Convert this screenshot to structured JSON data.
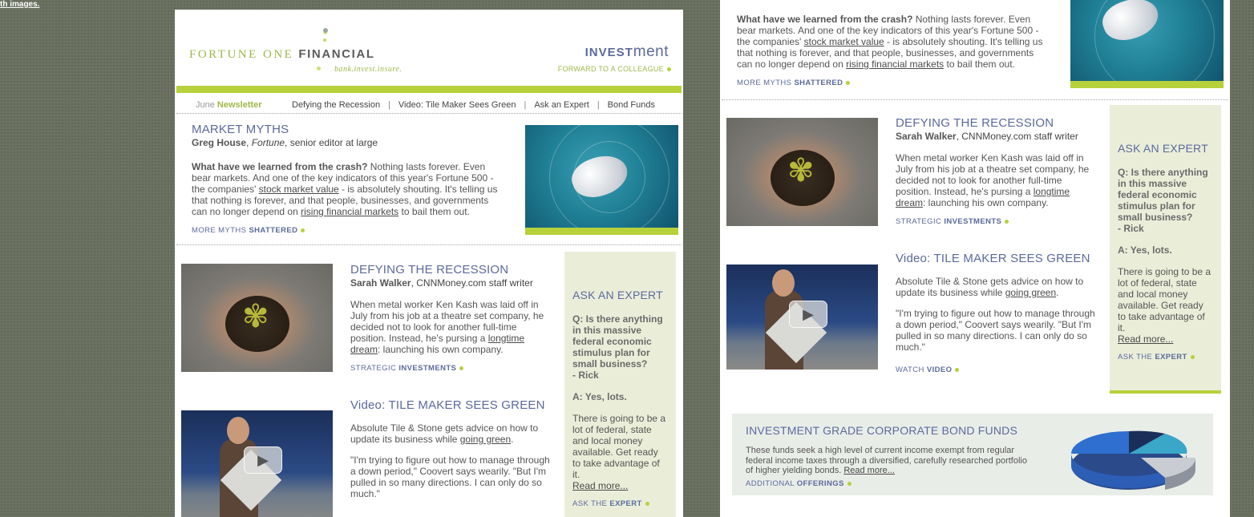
{
  "top_link": "th images.",
  "brand": {
    "name_part1": "FORTUNE ONE",
    "name_part2": "FINANCIAL",
    "tagline": "bank.invest.insure.",
    "section_bold": "INVEST",
    "section_rest": "ment",
    "forward": "FORWARD TO A COLLEAGUE"
  },
  "nav": {
    "issue_month": "June",
    "issue_word": "Newsletter",
    "items": [
      "Defying the Recession",
      "Video: Tile Maker Sees Green",
      "Ask an Expert",
      "Bond Funds"
    ],
    "separator": "|"
  },
  "market_myths": {
    "title": "MARKET MYTHS",
    "author": "Greg House",
    "publication": "Fortune",
    "role": ", senior editor at large",
    "lead": "What have we learned from the crash?",
    "text1": " Nothing lasts forever. Even bear markets. And one of the key indicators of this year's Fortune 500 - the companies' ",
    "link1": "stock market value",
    "text2": " - is absolutely shouting. It's telling us that nothing is forever, and that people, businesses, and governments can no longer depend on ",
    "link2": "rising financial markets",
    "text3": " to bail them out.",
    "more_pre": "MORE MYTHS",
    "more_bold": "SHATTERED"
  },
  "defying": {
    "title": "DEFYING THE RECESSION",
    "author": "Sarah Walker",
    "role": ", CNNMoney.com staff writer",
    "text1": "When metal worker Ken Kash was laid off in July from his job at a theatre set company, he decided not to look for another full-time position. Instead, he's pursing a ",
    "link": "longtime dream",
    "text2": ": launching his own company.",
    "more_pre": "STRATEGIC",
    "more_bold": "INVESTMENTS"
  },
  "video": {
    "title": "Video: TILE MAKER SEES GREEN",
    "text1": "Absolute Tile & Stone gets advice on how to update its business while ",
    "link": "going green",
    "text2": ".",
    "quote": "\"I'm trying to figure out how to manage through a down period,\" Coovert says wearily. \"But I'm pulled in so many directions. I can only do so much.\"",
    "more_pre": "WATCH",
    "more_bold": "VIDEO"
  },
  "expert": {
    "title": "ASK AN EXPERT",
    "question": "Q: Is there anything in this massive federal economic stimulus plan for small business?",
    "asker": "- Rick",
    "answer": "A: Yes, lots.",
    "text": "There is going to be a lot of federal, state and local money available. Get ready to take advantage of it.",
    "read_more": "Read more...",
    "more_pre": "ASK THE",
    "more_bold": "EXPERT"
  },
  "bond": {
    "title": "INVESTMENT GRADE CORPORATE BOND FUNDS",
    "text": "These funds seek a high level of current income exempt from regular federal income taxes through a diversified, carefully researched portfolio of higher yielding bonds. ",
    "read_more": "Read more...",
    "more_pre": "ADDITIONAL",
    "more_bold": "OFFERINGS"
  },
  "colors": {
    "accent_green": "#b7d13b",
    "heading_blue": "#5b6a9c",
    "expert_bg": "#eaeed9",
    "page_bg": "#6b7261"
  }
}
